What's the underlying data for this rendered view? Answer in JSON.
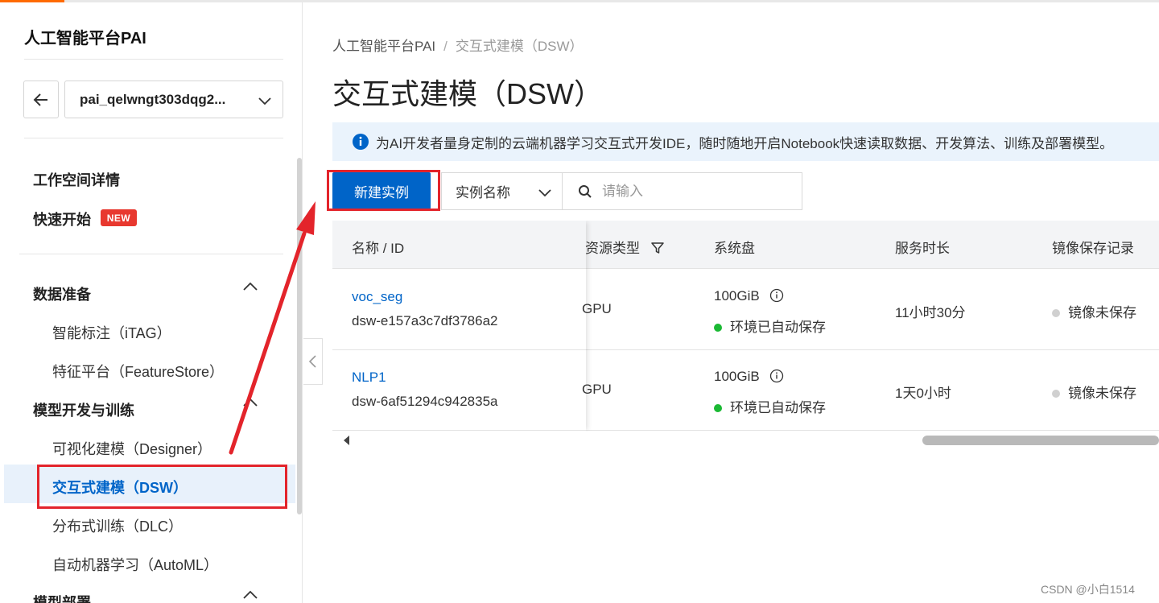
{
  "sidebar": {
    "title": "人工智能平台PAI",
    "workspace": "pai_qelwngt303dqg2...",
    "links": {
      "workspace_detail": "工作空间详情",
      "quick_start": "快速开始",
      "new_badge": "NEW"
    },
    "groups": [
      {
        "label": "数据准备",
        "items": [
          "智能标注（iTAG）",
          "特征平台（FeatureStore）"
        ]
      },
      {
        "label": "模型开发与训练",
        "items": [
          "可视化建模（Designer）",
          "交互式建模（DSW）",
          "分布式训练（DLC）",
          "自动机器学习（AutoML）"
        ]
      },
      {
        "label": "模型部署"
      }
    ],
    "active_item": "交互式建模（DSW）"
  },
  "breadcrumb": {
    "root": "人工智能平台PAI",
    "sep": "/",
    "current": "交互式建模（DSW）"
  },
  "page_title": "交互式建模（DSW）",
  "info_text": "为AI开发者量身定制的云端机器学习交互式开发IDE，随时随地开启Notebook快速读取数据、开发算法、训练及部署模型。",
  "toolbar": {
    "create_label": "新建实例",
    "filter_selected": "实例名称",
    "search_placeholder": "请输入"
  },
  "table": {
    "columns": [
      "名称 / ID",
      "资源类型",
      "系统盘",
      "服务时长",
      "镜像保存记录"
    ],
    "rows": [
      {
        "name": "voc_seg",
        "id": "dsw-e157a3c7df3786a2",
        "resource": "GPU",
        "disk": "100GiB",
        "disk_status": "环境已自动保存",
        "duration": "11小时30分",
        "image_status": "镜像未保存"
      },
      {
        "name": "NLP1",
        "id": "dsw-6af51294c942835a",
        "resource": "GPU",
        "disk": "100GiB",
        "disk_status": "环境已自动保存",
        "duration": "1天0小时",
        "image_status": "镜像未保存"
      }
    ]
  },
  "watermark": "CSDN @小白1514",
  "colors": {
    "brand": "#0064c8",
    "accent": "#ff6a00",
    "annotation": "#e3242b",
    "status_ok": "#1bb934",
    "status_none": "#d0d0d0",
    "badge": "#e8382f"
  },
  "icons": {
    "back": "arrow-left-icon",
    "info": "info-icon",
    "search": "search-icon",
    "filter": "funnel-icon",
    "collapse": "chevron-left-icon"
  }
}
